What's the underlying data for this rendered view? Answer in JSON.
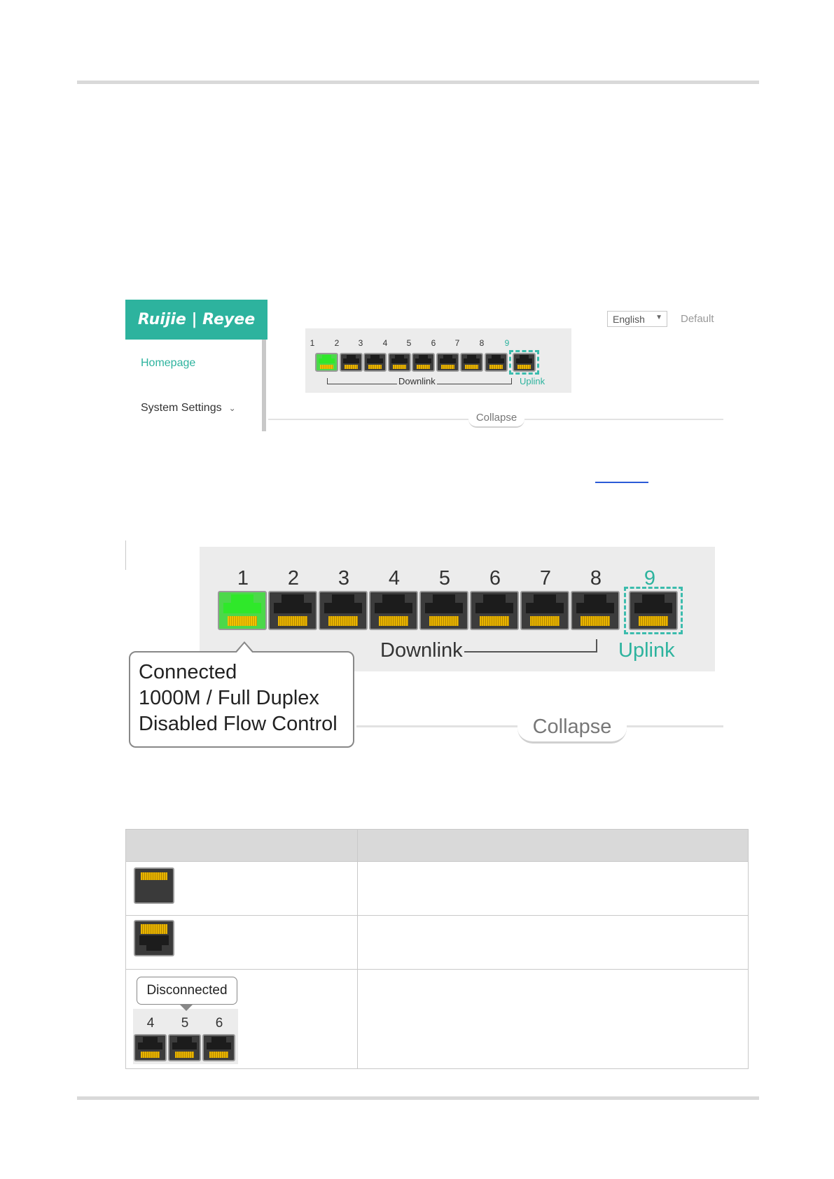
{
  "screenshot1": {
    "brand": "Ruijie | Reyee",
    "nav": {
      "homepage": "Homepage",
      "system_settings": "System Settings",
      "chevron_icon": "chevron-down-icon"
    },
    "language": "English",
    "default_label": "Default",
    "ports": [
      "1",
      "2",
      "3",
      "4",
      "5",
      "6",
      "7",
      "8",
      "9"
    ],
    "downlink_label": "Downlink",
    "uplink_label": "Uplink",
    "collapse_label": "Collapse",
    "colors": {
      "brand": "#2db39e",
      "port_connected": "#2fe82a",
      "port_idle": "#1c1c1c"
    }
  },
  "screenshot2": {
    "ports": [
      "1",
      "2",
      "3",
      "4",
      "5",
      "6",
      "7",
      "8",
      "9"
    ],
    "downlink_label": "Downlink",
    "uplink_label": "Uplink",
    "collapse_label": "Collapse",
    "tooltip": {
      "line1": "Connected",
      "line2": "1000M / Full Duplex",
      "line3": "Disabled Flow Control"
    }
  },
  "legend_table": {
    "rows": [
      {
        "icon": "sfp-port-icon"
      },
      {
        "icon": "ethernet-port-icon"
      },
      {
        "icon": "disconnected-ports-icon",
        "tooltip": "Disconnected",
        "ports": [
          "4",
          "5",
          "6"
        ]
      }
    ]
  }
}
